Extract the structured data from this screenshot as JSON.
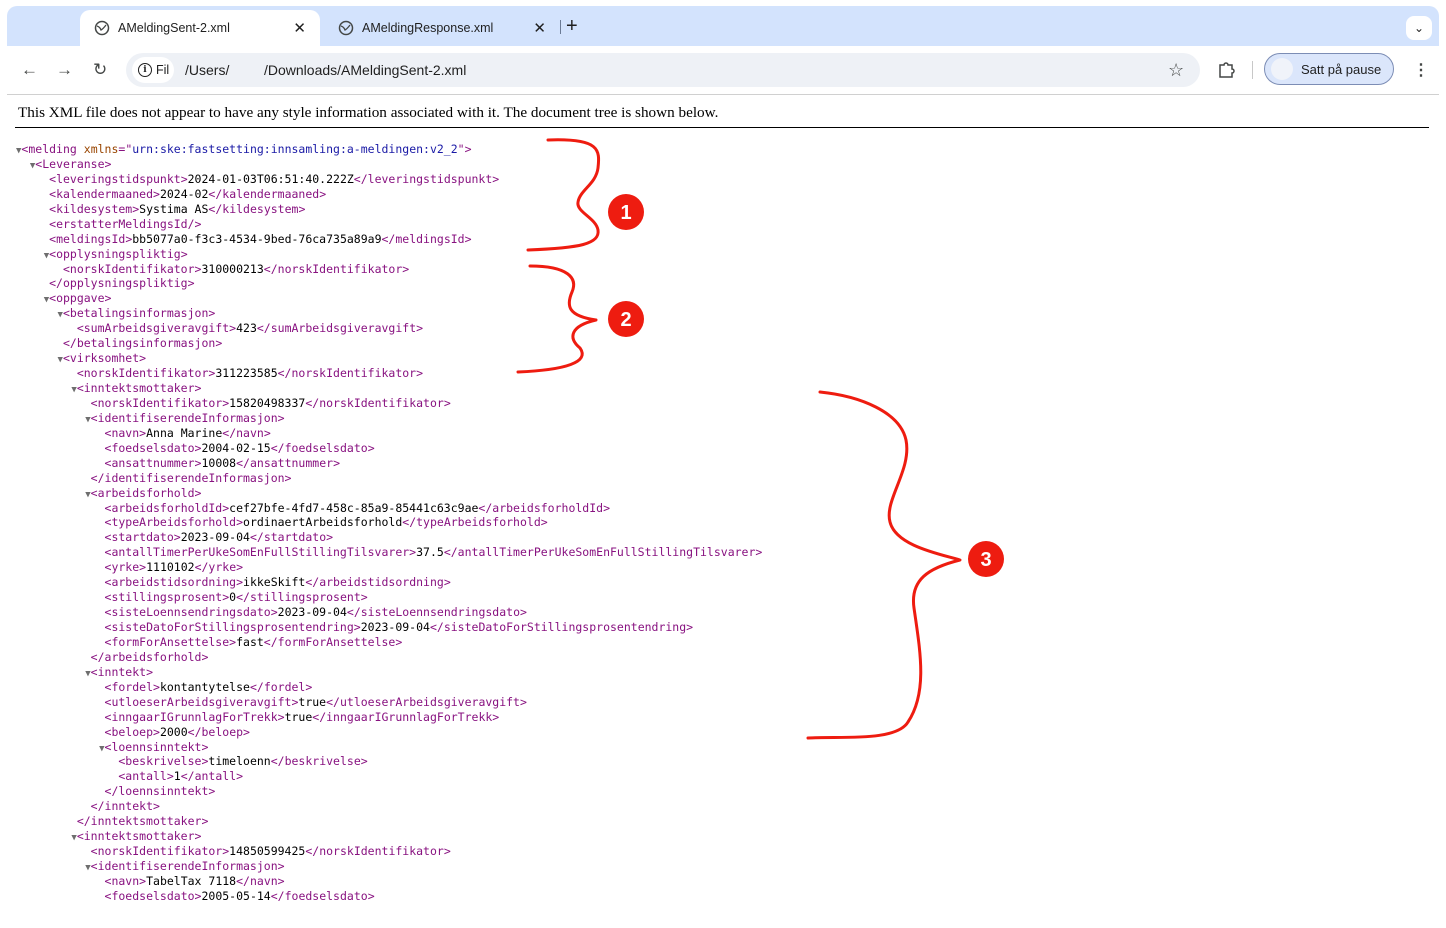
{
  "tabs": [
    {
      "title": "AMeldingSent-2.xml",
      "active": true
    },
    {
      "title": "AMeldingResponse.xml",
      "active": false
    }
  ],
  "address_bar": {
    "scheme_chip": "Fil",
    "path_before_redaction": "/Users/",
    "path_after_redaction": "/Downloads/AMeldingSent-2.xml"
  },
  "profile_button": "Satt på pause",
  "info_message": "This XML file does not appear to have any style information associated with it. The document tree is shown below.",
  "xml_lines": [
    {
      "depth": 0,
      "toggle": "▼",
      "open": "melding",
      "attrs": [
        {
          "name": "xmlns",
          "value": "urn:ske:fastsetting:innsamling:a-meldingen:v2_2"
        }
      ]
    },
    {
      "depth": 1,
      "toggle": "▼",
      "open": "Leveranse"
    },
    {
      "depth": 2,
      "open": "leveringstidspunkt",
      "text": "2024-01-03T06:51:40.222Z",
      "close": "leveringstidspunkt"
    },
    {
      "depth": 2,
      "open": "kalendermaaned",
      "text": "2024-02",
      "close": "kalendermaaned"
    },
    {
      "depth": 2,
      "open": "kildesystem",
      "text": "Systima AS",
      "close": "kildesystem"
    },
    {
      "depth": 2,
      "selfclose": "erstatterMeldingsId"
    },
    {
      "depth": 2,
      "open": "meldingsId",
      "text": "bb5077a0-f3c3-4534-9bed-76ca735a89a9",
      "close": "meldingsId"
    },
    {
      "depth": 2,
      "toggle": "▼",
      "open": "opplysningspliktig"
    },
    {
      "depth": 3,
      "open": "norskIdentifikator",
      "text": "310000213",
      "close": "norskIdentifikator"
    },
    {
      "depth": 2,
      "close": "opplysningspliktig"
    },
    {
      "depth": 2,
      "toggle": "▼",
      "open": "oppgave"
    },
    {
      "depth": 3,
      "toggle": "▼",
      "open": "betalingsinformasjon"
    },
    {
      "depth": 4,
      "open": "sumArbeidsgiveravgift",
      "text": "423",
      "close": "sumArbeidsgiveravgift"
    },
    {
      "depth": 3,
      "close": "betalingsinformasjon"
    },
    {
      "depth": 3,
      "toggle": "▼",
      "open": "virksomhet"
    },
    {
      "depth": 4,
      "open": "norskIdentifikator",
      "text": "311223585",
      "close": "norskIdentifikator"
    },
    {
      "depth": 4,
      "toggle": "▼",
      "open": "inntektsmottaker"
    },
    {
      "depth": 5,
      "open": "norskIdentifikator",
      "text": "15820498337",
      "close": "norskIdentifikator"
    },
    {
      "depth": 5,
      "toggle": "▼",
      "open": "identifiserendeInformasjon"
    },
    {
      "depth": 6,
      "open": "navn",
      "text": "Anna Marine",
      "close": "navn"
    },
    {
      "depth": 6,
      "open": "foedselsdato",
      "text": "2004-02-15",
      "close": "foedselsdato"
    },
    {
      "depth": 6,
      "open": "ansattnummer",
      "text": "10008",
      "close": "ansattnummer"
    },
    {
      "depth": 5,
      "close": "identifiserendeInformasjon"
    },
    {
      "depth": 5,
      "toggle": "▼",
      "open": "arbeidsforhold"
    },
    {
      "depth": 6,
      "open": "arbeidsforholdId",
      "text": "cef27bfe-4fd7-458c-85a9-85441c63c9ae",
      "close": "arbeidsforholdId"
    },
    {
      "depth": 6,
      "open": "typeArbeidsforhold",
      "text": "ordinaertArbeidsforhold",
      "close": "typeArbeidsforhold"
    },
    {
      "depth": 6,
      "open": "startdato",
      "text": "2023-09-04",
      "close": "startdato"
    },
    {
      "depth": 6,
      "open": "antallTimerPerUkeSomEnFullStillingTilsvarer",
      "text": "37.5",
      "close": "antallTimerPerUkeSomEnFullStillingTilsvarer"
    },
    {
      "depth": 6,
      "open": "yrke",
      "text": "1110102",
      "close": "yrke"
    },
    {
      "depth": 6,
      "open": "arbeidstidsordning",
      "text": "ikkeSkift",
      "close": "arbeidstidsordning"
    },
    {
      "depth": 6,
      "open": "stillingsprosent",
      "text": "0",
      "close": "stillingsprosent"
    },
    {
      "depth": 6,
      "open": "sisteLoennsendringsdato",
      "text": "2023-09-04",
      "close": "sisteLoennsendringsdato"
    },
    {
      "depth": 6,
      "open": "sisteDatoForStillingsprosentendring",
      "text": "2023-09-04",
      "close": "sisteDatoForStillingsprosentendring"
    },
    {
      "depth": 6,
      "open": "formForAnsettelse",
      "text": "fast",
      "close": "formForAnsettelse"
    },
    {
      "depth": 5,
      "close": "arbeidsforhold"
    },
    {
      "depth": 5,
      "toggle": "▼",
      "open": "inntekt"
    },
    {
      "depth": 6,
      "open": "fordel",
      "text": "kontantytelse",
      "close": "fordel"
    },
    {
      "depth": 6,
      "open": "utloeserArbeidsgiveravgift",
      "text": "true",
      "close": "utloeserArbeidsgiveravgift"
    },
    {
      "depth": 6,
      "open": "inngaarIGrunnlagForTrekk",
      "text": "true",
      "close": "inngaarIGrunnlagForTrekk"
    },
    {
      "depth": 6,
      "open": "beloep",
      "text": "2000",
      "close": "beloep"
    },
    {
      "depth": 6,
      "toggle": "▼",
      "open": "loennsinntekt"
    },
    {
      "depth": 7,
      "open": "beskrivelse",
      "text": "timeloenn",
      "close": "beskrivelse"
    },
    {
      "depth": 7,
      "open": "antall",
      "text": "1",
      "close": "antall"
    },
    {
      "depth": 6,
      "close": "loennsinntekt"
    },
    {
      "depth": 5,
      "close": "inntekt"
    },
    {
      "depth": 4,
      "close": "inntektsmottaker"
    },
    {
      "depth": 4,
      "toggle": "▼",
      "open": "inntektsmottaker"
    },
    {
      "depth": 5,
      "open": "norskIdentifikator",
      "text": "14850599425",
      "close": "norskIdentifikator"
    },
    {
      "depth": 5,
      "toggle": "▼",
      "open": "identifiserendeInformasjon"
    },
    {
      "depth": 6,
      "open": "navn",
      "text": "TabelTax 7118",
      "close": "navn"
    },
    {
      "depth": 6,
      "open": "foedselsdato",
      "text": "2005-05-14",
      "close": "foedselsdato"
    }
  ],
  "annotations": [
    {
      "label": "1",
      "color": "#ee1c10"
    },
    {
      "label": "2",
      "color": "#ee1c10"
    },
    {
      "label": "3",
      "color": "#ee1c10"
    }
  ]
}
